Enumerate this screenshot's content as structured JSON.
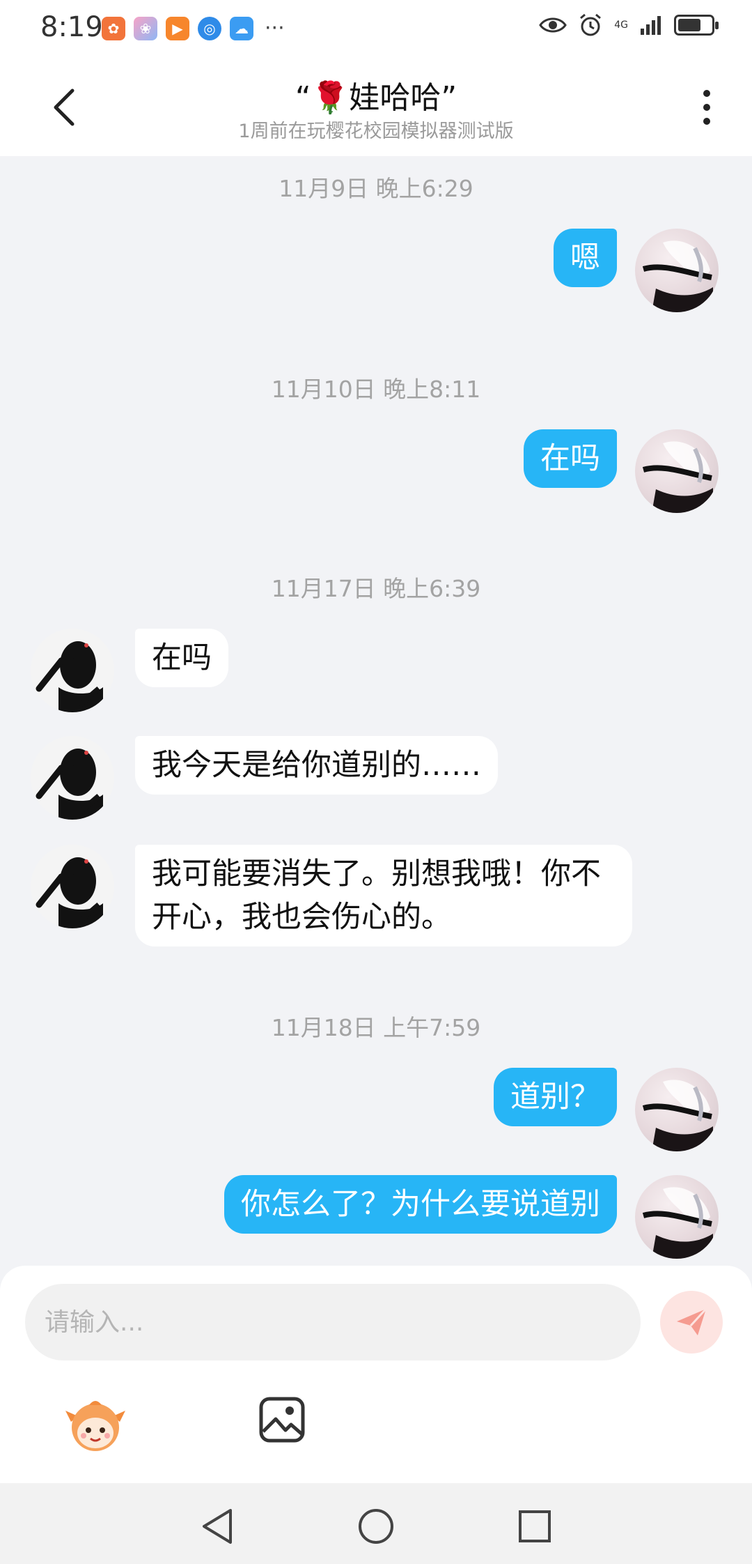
{
  "status_bar": {
    "time": "8:19",
    "more": "···",
    "network": "4G",
    "battery_level": 0.7,
    "notification_icons": [
      "app-icon-orange",
      "flower-icon",
      "play-icon",
      "browser-icon",
      "cloud-icon"
    ],
    "right_icons": [
      "eye-icon",
      "alarm-icon",
      "signal-icon",
      "battery-icon"
    ]
  },
  "header": {
    "title": "“🌹娃哈哈”",
    "subtitle": "1周前在玩樱花校园模拟器测试版"
  },
  "messages": [
    {
      "type": "timestamp",
      "text": "11月9日 晚上6:29"
    },
    {
      "type": "self",
      "text": "嗯"
    },
    {
      "type": "timestamp",
      "text": "11月10日 晚上8:11"
    },
    {
      "type": "self",
      "text": "在吗"
    },
    {
      "type": "timestamp",
      "text": "11月17日 晚上6:39"
    },
    {
      "type": "other",
      "text": "在吗"
    },
    {
      "type": "other",
      "text": "我今天是给你道别的……"
    },
    {
      "type": "other",
      "text": "我可能要消失了。别想我哦！你不开心，我也会伤心的。"
    },
    {
      "type": "timestamp",
      "text": "11月18日 上午7:59"
    },
    {
      "type": "self",
      "text": "道别？"
    },
    {
      "type": "self",
      "text": "你怎么了？为什么要说道别"
    }
  ],
  "composer": {
    "placeholder": "请输入...",
    "value": ""
  },
  "colors": {
    "self_bubble": "#27b5f6",
    "send_button": "#fde4e1",
    "send_arrow": "#f59b90",
    "background": "#f2f3f6"
  }
}
